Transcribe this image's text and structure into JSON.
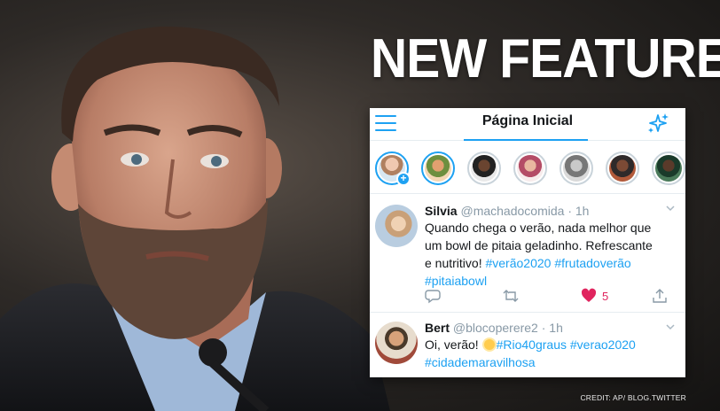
{
  "headline": "NEW FEATURE",
  "credit": "CREDIT: AP/ BLOG.TWITTER",
  "colors": {
    "accent": "#1da1f2",
    "like": "#e0245e",
    "muted": "#8899a6"
  },
  "app": {
    "title": "Página Inicial",
    "menu_icon": "hamburger-menu-icon",
    "top_icon": "sparkle-icon"
  },
  "fleets": [
    {
      "kind": "own",
      "icon": "add-fleet-icon"
    },
    {
      "kind": "user"
    },
    {
      "kind": "user"
    },
    {
      "kind": "user"
    },
    {
      "kind": "user"
    },
    {
      "kind": "user"
    },
    {
      "kind": "user"
    }
  ],
  "tweets": [
    {
      "name": "Silvia",
      "handle": "@machadocomida",
      "time": "· 1h",
      "text_line1": "Quando chega o verão, nada melhor que",
      "text_line2": "um bowl de pitaia geladinho. Refrescante",
      "text_line3_plain": "e nutritivo! ",
      "text_line3_tags": "#verão2020 #frutadoverão",
      "text_line4_tags": "#pitaiabowl",
      "likes": "5"
    },
    {
      "name": "Bert",
      "handle": "@blocoperere2",
      "time": "· 1h",
      "text_line1_plain": "Oi, verão! ",
      "text_line1_tags": "#Rio40graus #verao2020",
      "text_line2_tags": "#cidademaravilhosa"
    }
  ]
}
